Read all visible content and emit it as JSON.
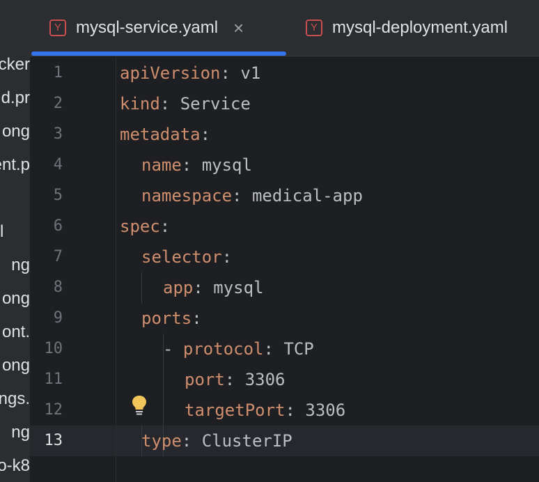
{
  "sidebar": {
    "items": [
      "cker",
      "d.pr",
      "ong",
      "ent.p",
      "l",
      "ng",
      "ong",
      "ont.",
      "ong",
      "ngs.",
      "ng",
      "o-k8"
    ]
  },
  "tabs": [
    {
      "label": "mysql-service.yaml",
      "icon": "yaml-icon",
      "active": true,
      "close": "×"
    },
    {
      "label": "mysql-deployment.yaml",
      "icon": "yaml-icon",
      "active": false
    }
  ],
  "editor": {
    "current_line": 13,
    "lines": [
      {
        "num": "1",
        "key": "apiVersion",
        "sep": ": ",
        "value": "v1"
      },
      {
        "num": "2",
        "key": "kind",
        "sep": ": ",
        "value": "Service"
      },
      {
        "num": "3",
        "key": "metadata",
        "sep": ":",
        "value": ""
      },
      {
        "num": "4",
        "key": "name",
        "sep": ": ",
        "value": "mysql"
      },
      {
        "num": "5",
        "key": "namespace",
        "sep": ": ",
        "value": "medical-app"
      },
      {
        "num": "6",
        "key": "spec",
        "sep": ":",
        "value": ""
      },
      {
        "num": "7",
        "key": "selector",
        "sep": ":",
        "value": ""
      },
      {
        "num": "8",
        "key": "app",
        "sep": ": ",
        "value": "mysql"
      },
      {
        "num": "9",
        "key": "ports",
        "sep": ":",
        "value": ""
      },
      {
        "num": "10",
        "dash": "- ",
        "key": "protocol",
        "sep": ": ",
        "value": "TCP"
      },
      {
        "num": "11",
        "key": "port",
        "sep": ": ",
        "value": "3306"
      },
      {
        "num": "12",
        "key": "targetPort",
        "sep": ": ",
        "value": "3306"
      },
      {
        "num": "13",
        "key": "type",
        "sep": ": ",
        "value": "ClusterIP"
      }
    ]
  },
  "colors": {
    "accent": "#3574f0",
    "key": "#cf8e6d",
    "text": "#bcbec4",
    "background": "#1e1f22"
  },
  "icons": {
    "intention": "lightbulb-icon"
  }
}
